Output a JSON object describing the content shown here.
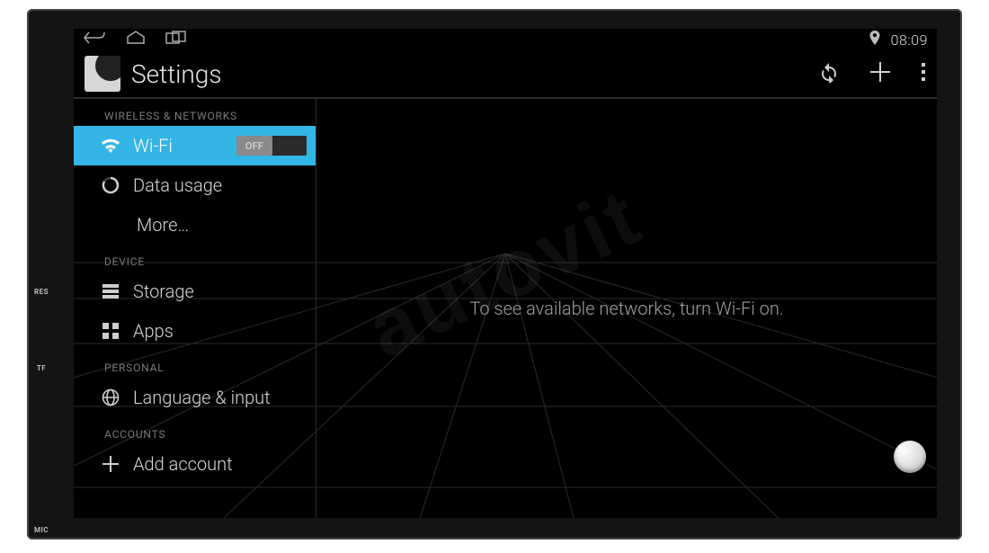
{
  "hardware": {
    "labels": {
      "res": "RES",
      "tf": "TF",
      "mic": "MIC"
    }
  },
  "statusbar": {
    "time": "08:09"
  },
  "actionbar": {
    "title": "Settings"
  },
  "sidebar": {
    "sections": {
      "wireless_header": "WIRELESS & NETWORKS",
      "device_header": "DEVICE",
      "personal_header": "PERSONAL",
      "accounts_header": "ACCOUNTS"
    },
    "items": {
      "wifi": {
        "label": "Wi-Fi",
        "toggle": "OFF"
      },
      "data_usage": {
        "label": "Data usage"
      },
      "more": {
        "label": "More…"
      },
      "storage": {
        "label": "Storage"
      },
      "apps": {
        "label": "Apps"
      },
      "lang_input": {
        "label": "Language & input"
      },
      "add_account": {
        "label": "Add account"
      }
    }
  },
  "content": {
    "message": "To see available networks, turn Wi-Fi on."
  },
  "watermark": "autovit"
}
